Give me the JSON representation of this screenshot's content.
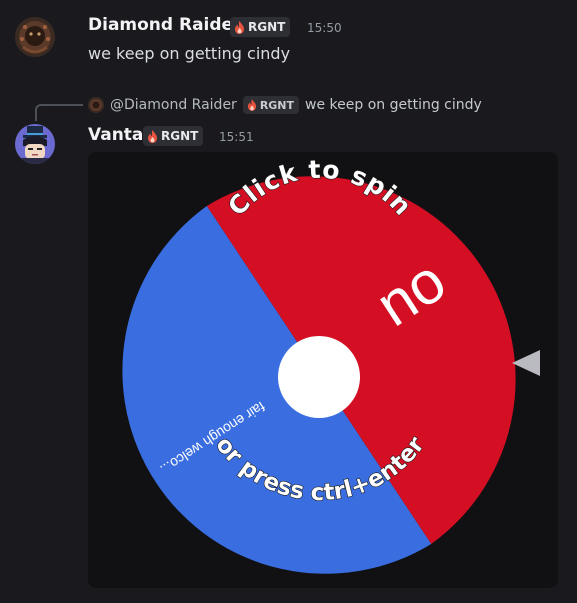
{
  "messages": [
    {
      "username": "Diamond Raider",
      "tag": "RGNT",
      "time": "15:50",
      "text": "we keep on getting cindy"
    },
    {
      "username": "Vanta",
      "tag": "RGNT",
      "time": "15:51",
      "reply": {
        "username": "@Diamond Raider",
        "tag": "RGNT",
        "text": "we keep on getting cindy"
      }
    }
  ],
  "wheel": {
    "top_prompt": "Click to spin",
    "bottom_prompt": "or press ctrl+enter",
    "segments": [
      {
        "label": "no",
        "color": "#d40f24"
      },
      {
        "label": "fair enough welco...",
        "color": "#3a6ee0"
      }
    ],
    "pointer_color": "#b9bbc0"
  },
  "colors": {
    "background": "#1a1a1e",
    "tag_background": "#2e2f35",
    "flame": "#e8533f"
  }
}
